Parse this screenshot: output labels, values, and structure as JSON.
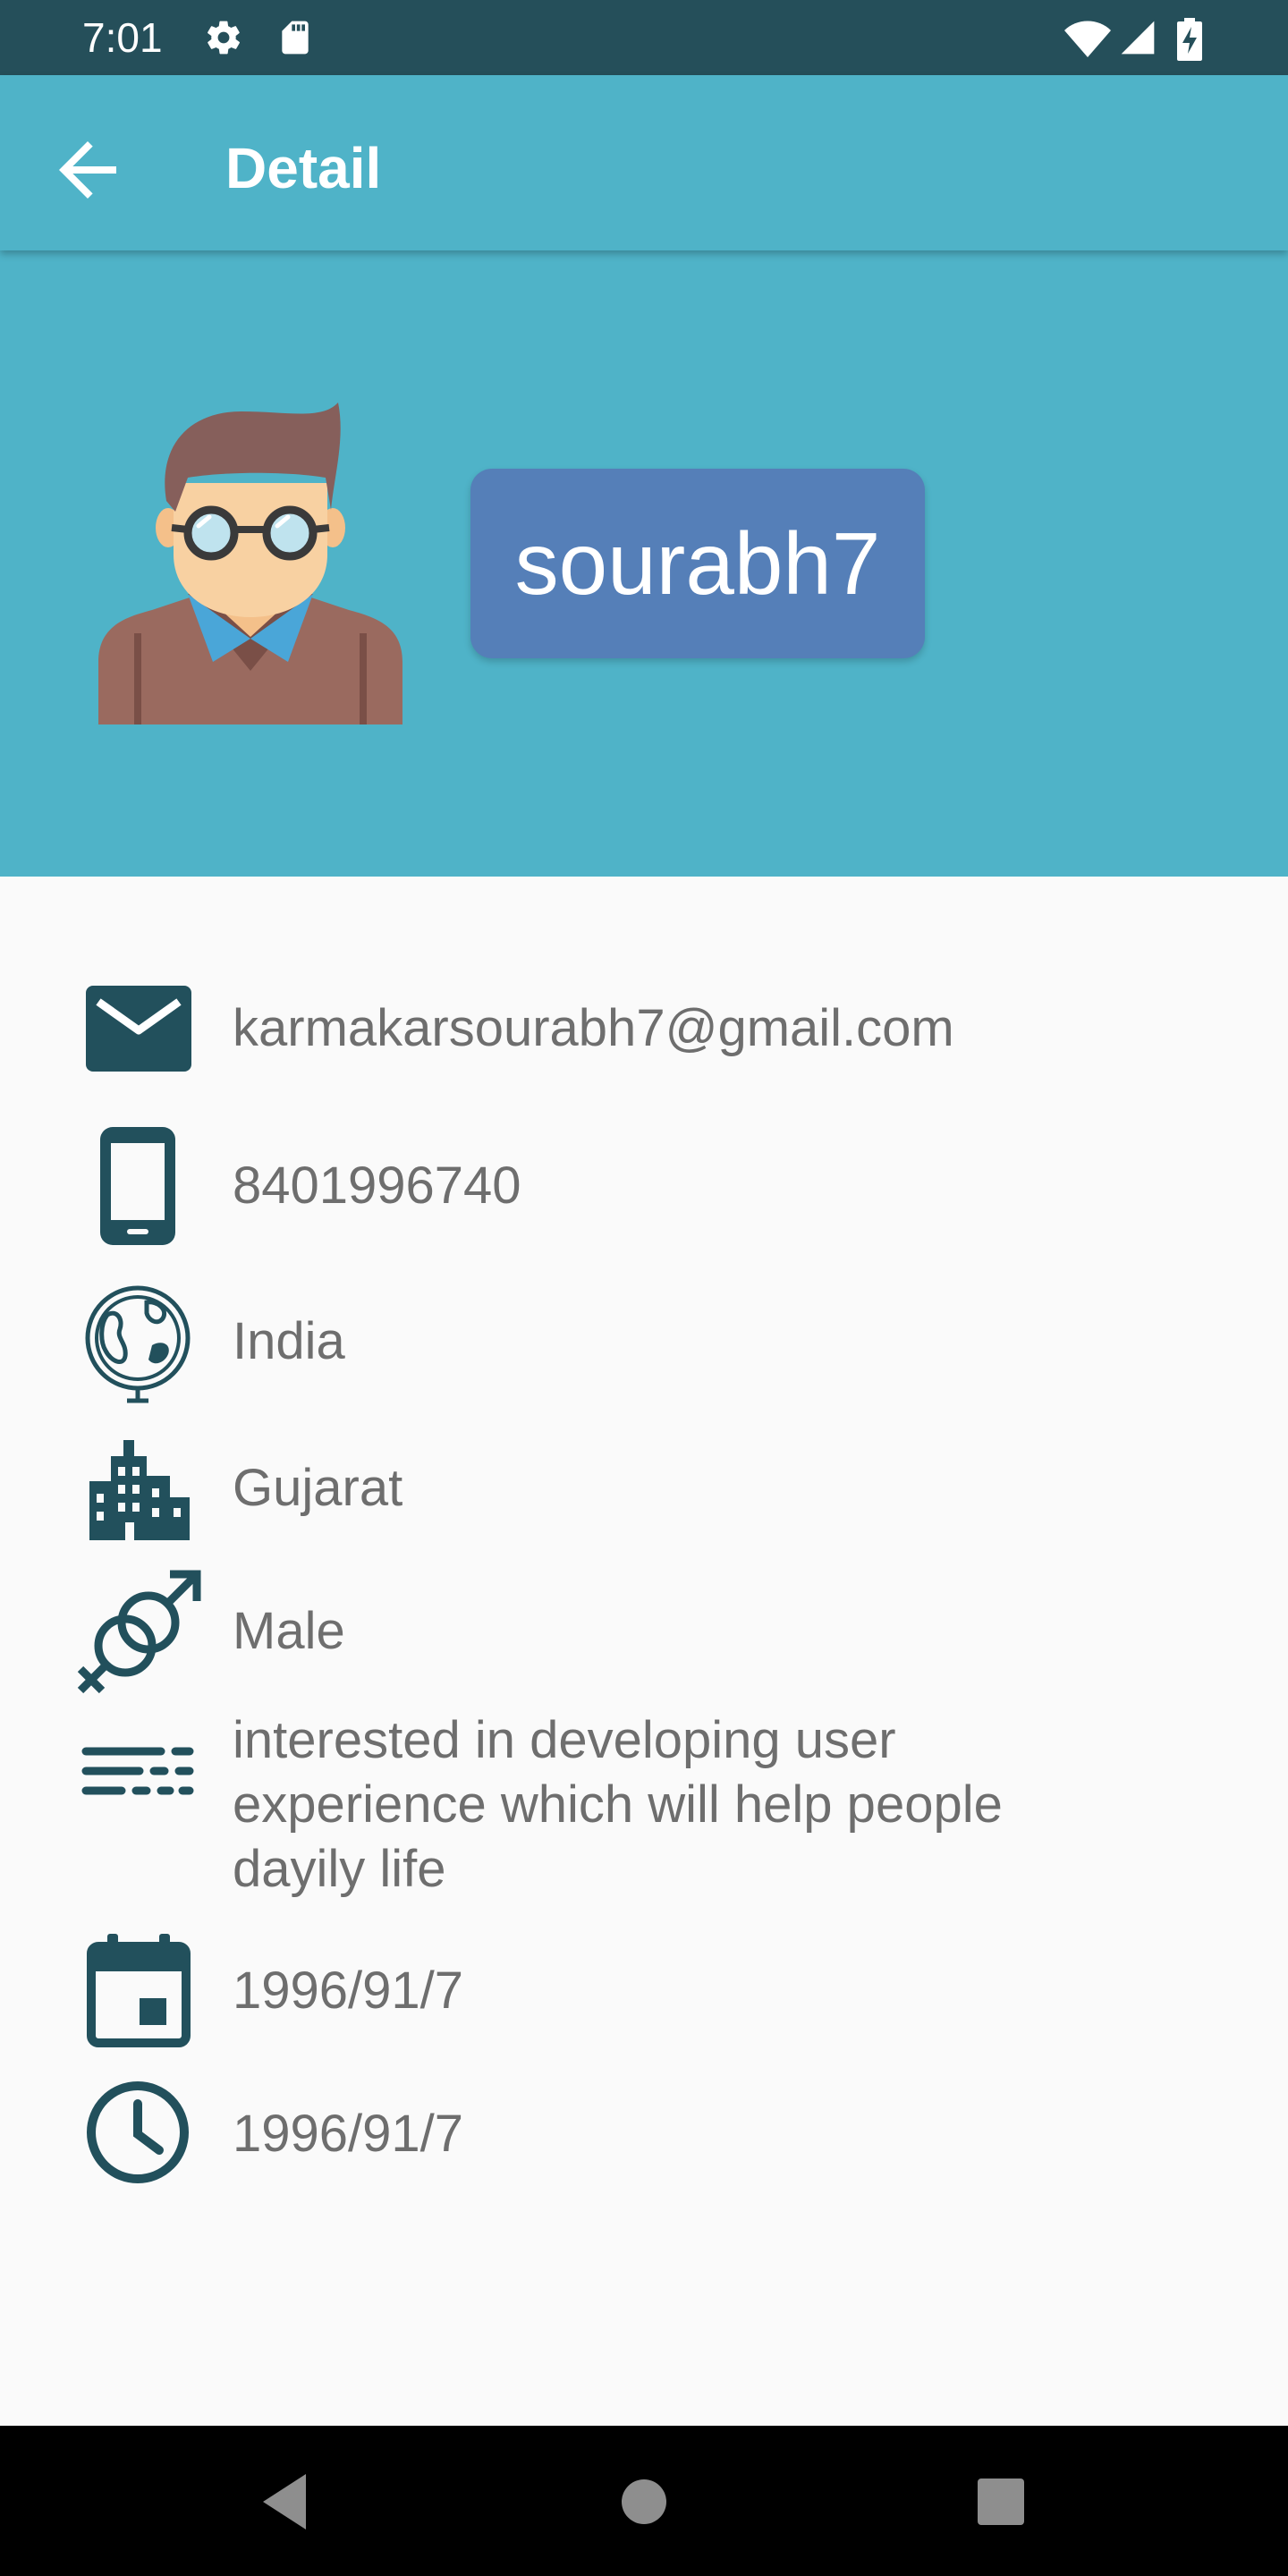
{
  "status_bar": {
    "time": "7:01",
    "icons": [
      "settings-icon",
      "sd-card-icon",
      "wifi-icon",
      "signal-icon",
      "battery-charging-icon"
    ]
  },
  "app_bar": {
    "title": "Detail",
    "back_icon": "arrow-back-icon"
  },
  "profile": {
    "avatar_icon": "user-avatar-icon",
    "username": "sourabh7"
  },
  "details": [
    {
      "icon": "email-icon",
      "text": "karmakarsourabh7@gmail.com"
    },
    {
      "icon": "phone-icon",
      "text": "8401996740"
    },
    {
      "icon": "globe-icon",
      "text": "India"
    },
    {
      "icon": "city-icon",
      "text": "Gujarat"
    },
    {
      "icon": "gender-icon",
      "text": "Male"
    },
    {
      "icon": "description-icon",
      "text": "interested in developing user experience which will help people dayily life"
    },
    {
      "icon": "calendar-icon",
      "text": "1996/91/7"
    },
    {
      "icon": "clock-icon",
      "text": "1996/91/7"
    }
  ],
  "nav_bar": {
    "icons": [
      "nav-back-icon",
      "nav-home-icon",
      "nav-recents-icon"
    ]
  },
  "colors": {
    "status_bar": "#254f5a",
    "primary": "#4fb3c8",
    "chip": "#557fb8",
    "icon": "#22505c",
    "text": "#6e6e6e"
  }
}
